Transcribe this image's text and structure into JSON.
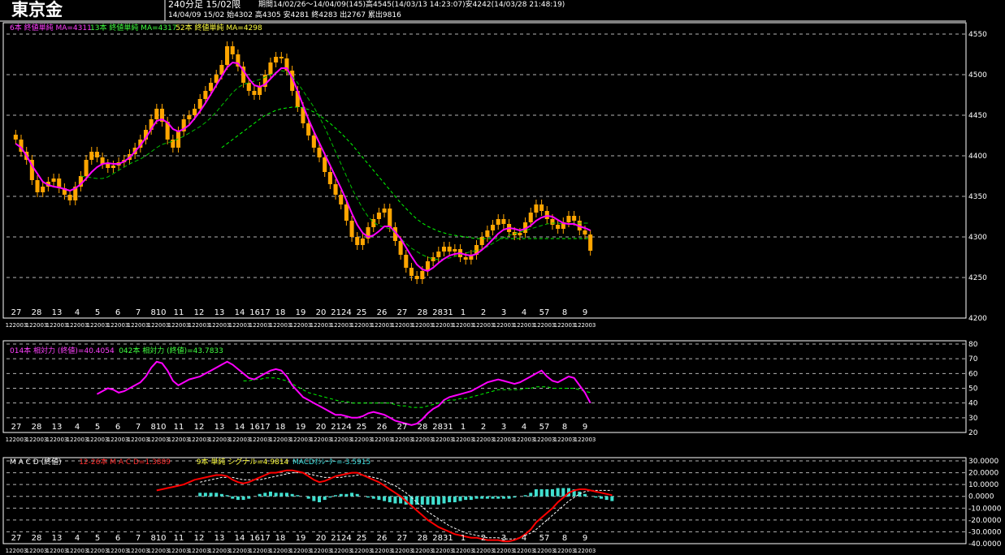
{
  "header": {
    "symbol": "東京金",
    "timeframe": "240分足 15/02限",
    "period": "期間14/02/26～14/04/09(145)高4545(14/03/13 14:23:07)安4242(14/03/28 21:48:19)",
    "current": "14/04/09 15/02 始4302 高4305 安4281 終4283 出2767 累出9816"
  },
  "colors": {
    "up": "#ffa500",
    "ma6": "#ff00ff",
    "ma13": "#00ff00",
    "ma52": "#ffff00",
    "macd": "#ff0000",
    "signal": "#ffffff",
    "osc": "#40e0d0",
    "grid": "#ffffff"
  },
  "legends": {
    "price": [
      {
        "text": "6本 終値単純 MA=4311",
        "color": "#ff40ff"
      },
      {
        "text": "13本 終値単純 MA=4317",
        "color": "#40ff40"
      },
      {
        "text": "52本 終値単純 MA=4298",
        "color": "#ffff40"
      }
    ],
    "rsi": [
      {
        "text": "014本 相対力 (終値)=40.4054",
        "color": "#ff40ff"
      },
      {
        "text": "042本 相対力 (終値)=43.7833",
        "color": "#40ff40"
      }
    ],
    "macd": [
      {
        "text": "M A C D (終値)",
        "color": "#ffffff"
      },
      {
        "text": "12-26本 M A C D=1.3889",
        "color": "#ff3030"
      },
      {
        "text": "9本 単純 シグナル=4.9814",
        "color": "#ffff40"
      },
      {
        "text": "MACDｵｼﾚｰﾀｰ=-3.5915",
        "color": "#40e0e0"
      }
    ]
  },
  "x_day_labels": [
    "27",
    "28",
    "13",
    "4",
    "5",
    "6",
    "7",
    "810",
    "11",
    "12",
    "13",
    "14",
    "1617",
    "18",
    "19",
    "20",
    "2124",
    "25",
    "26",
    "27",
    "28",
    "2831",
    "1",
    "2",
    "3",
    "4",
    "57",
    "8",
    "9"
  ],
  "rsi_x_day_labels": [
    "27",
    "28",
    "13",
    "4",
    "5",
    "6",
    "7",
    "810",
    "11",
    "12",
    "13",
    "14",
    "1617",
    "18",
    "19",
    "20",
    "2124",
    "25",
    "26",
    "27",
    "28",
    "2831",
    "1",
    "2",
    "3",
    "4",
    "57",
    "8",
    "9"
  ],
  "x_hour_label": "12 20 03",
  "chart_data": [
    {
      "type": "candlestick",
      "title": "東京金 240分足 15/02限",
      "ylim": [
        4200,
        4560
      ],
      "y_ticks": [
        4200,
        4250,
        4300,
        4350,
        4400,
        4450,
        4500,
        4550
      ],
      "closes": [
        4420,
        4405,
        4395,
        4370,
        4355,
        4362,
        4368,
        4372,
        4360,
        4352,
        4345,
        4362,
        4375,
        4395,
        4405,
        4398,
        4390,
        4385,
        4388,
        4392,
        4395,
        4402,
        4410,
        4420,
        4432,
        4445,
        4458,
        4442,
        4420,
        4410,
        4430,
        4445,
        4450,
        4458,
        4470,
        4480,
        4490,
        4500,
        4512,
        4535,
        4525,
        4510,
        4490,
        4480,
        4475,
        4485,
        4500,
        4515,
        4522,
        4520,
        4505,
        4480,
        4460,
        4440,
        4425,
        4410,
        4398,
        4380,
        4365,
        4352,
        4340,
        4320,
        4300,
        4290,
        4298,
        4312,
        4322,
        4330,
        4335,
        4312,
        4295,
        4278,
        4262,
        4252,
        4248,
        4258,
        4270,
        4275,
        4282,
        4288,
        4282,
        4285,
        4275,
        4272,
        4278,
        4290,
        4300,
        4308,
        4315,
        4322,
        4316,
        4306,
        4302,
        4305,
        4318,
        4330,
        4340,
        4332,
        4322,
        4315,
        4310,
        4318,
        4326,
        4320,
        4308,
        4303,
        4283
      ],
      "ma6": [
        4415,
        4410,
        4400,
        4388,
        4378,
        4368,
        4364,
        4362,
        4361,
        4359,
        4357,
        4360,
        4365,
        4372,
        4380,
        4386,
        4390,
        4391,
        4390,
        4390,
        4393,
        4398,
        4405,
        4413,
        4422,
        4433,
        4443,
        4445,
        4441,
        4433,
        4430,
        4433,
        4438,
        4446,
        4455,
        4465,
        4476,
        4487,
        4498,
        4509,
        4515,
        4514,
        4505,
        4495,
        4487,
        4485,
        4488,
        4495,
        4502,
        4508,
        4508,
        4496,
        4480,
        4462,
        4445,
        4430,
        4416,
        4402,
        4388,
        4374,
        4360,
        4345,
        4329,
        4315,
        4305,
        4300,
        4302,
        4307,
        4313,
        4313,
        4306,
        4298,
        4287,
        4276,
        4266,
        4260,
        4258,
        4262,
        4268,
        4273,
        4277,
        4279,
        4280,
        4278,
        4277,
        4279,
        4284,
        4290,
        4297,
        4304,
        4309,
        4311,
        4310,
        4308,
        4310,
        4314,
        4320,
        4324,
        4326,
        4325,
        4321,
        4317,
        4316,
        4316,
        4313,
        4311,
        4308
      ],
      "ma13": [
        null,
        null,
        null,
        null,
        null,
        null,
        null,
        null,
        null,
        null,
        null,
        null,
        4375,
        4374,
        4373,
        4372,
        4372,
        4374,
        4378,
        4382,
        4386,
        4390,
        4393,
        4396,
        4400,
        4405,
        4410,
        4414,
        4416,
        4418,
        4421,
        4424,
        4428,
        4432,
        4436,
        4441,
        4447,
        4454,
        4462,
        4470,
        4478,
        4484,
        4488,
        4490,
        4492,
        4494,
        4497,
        4500,
        4503,
        4505,
        4503,
        4498,
        4490,
        4480,
        4470,
        4460,
        4448,
        4435,
        4420,
        4405,
        4390,
        4375,
        4360,
        4347,
        4335,
        4325,
        4318,
        4314,
        4312,
        4310,
        4305,
        4298,
        4292,
        4286,
        4282,
        4278,
        4275,
        4273,
        4272,
        4273,
        4274,
        4276,
        4278,
        4280,
        4282,
        4283,
        4285,
        4288,
        4292,
        4296,
        4299,
        4302,
        4304,
        4306,
        4308,
        4310,
        4312,
        4314,
        4316,
        4317,
        4317,
        4316,
        4316,
        4317,
        4317,
        4317,
        4317
      ],
      "ma52": [
        null,
        null,
        null,
        null,
        null,
        null,
        null,
        null,
        null,
        null,
        null,
        null,
        null,
        null,
        null,
        null,
        null,
        null,
        null,
        null,
        null,
        null,
        null,
        null,
        null,
        null,
        null,
        null,
        null,
        null,
        null,
        null,
        null,
        null,
        null,
        null,
        null,
        null,
        4410,
        4415,
        4420,
        4425,
        4430,
        4435,
        4440,
        4445,
        4450,
        4453,
        4456,
        4458,
        4459,
        4460,
        4460,
        4459,
        4457,
        4454,
        4450,
        4445,
        4440,
        4434,
        4428,
        4421,
        4414,
        4406,
        4398,
        4390,
        4382,
        4374,
        4366,
        4358,
        4350,
        4342,
        4335,
        4328,
        4322,
        4317,
        4313,
        4310,
        4307,
        4305,
        4303,
        4302,
        4301,
        4300,
        4299,
        4298,
        4298,
        4298,
        4298,
        4298,
        4298,
        4298,
        4298,
        4298,
        4298,
        4298,
        4298,
        4298,
        4298,
        4298,
        4298,
        4298,
        4298,
        4298,
        4298,
        4298,
        4298
      ]
    },
    {
      "type": "line",
      "title": "相対力",
      "ylim": [
        20,
        80
      ],
      "y_ticks": [
        20,
        30,
        40,
        50,
        60,
        70,
        80
      ],
      "rsi14": [
        null,
        null,
        null,
        null,
        null,
        null,
        null,
        null,
        null,
        null,
        null,
        null,
        null,
        null,
        null,
        46,
        48,
        50,
        49,
        47,
        48,
        50,
        52,
        54,
        58,
        64,
        68,
        67,
        62,
        55,
        52,
        54,
        56,
        57,
        58,
        60,
        62,
        64,
        66,
        68,
        66,
        63,
        60,
        57,
        56,
        58,
        60,
        62,
        63,
        62,
        58,
        52,
        48,
        44,
        42,
        40,
        38,
        36,
        34,
        32,
        32,
        31,
        30,
        30,
        31,
        33,
        34,
        33,
        32,
        30,
        28,
        27,
        26,
        25,
        26,
        29,
        33,
        36,
        38,
        42,
        44,
        45,
        46,
        47,
        48,
        50,
        52,
        54,
        55,
        56,
        55,
        54,
        53,
        54,
        56,
        58,
        60,
        62,
        58,
        55,
        54,
        56,
        58,
        57,
        52,
        47,
        40
      ],
      "rsi42": [
        null,
        null,
        null,
        null,
        null,
        null,
        null,
        null,
        null,
        null,
        null,
        null,
        null,
        null,
        null,
        null,
        null,
        null,
        null,
        null,
        null,
        null,
        null,
        null,
        null,
        null,
        null,
        null,
        null,
        null,
        null,
        null,
        null,
        null,
        null,
        null,
        null,
        null,
        null,
        null,
        null,
        null,
        55,
        55,
        56,
        56,
        57,
        57,
        57,
        56,
        55,
        53,
        51,
        49,
        47,
        46,
        45,
        44,
        43,
        42,
        41,
        41,
        40,
        40,
        40,
        40,
        40,
        40,
        40,
        40,
        39,
        38,
        38,
        37,
        37,
        37,
        38,
        39,
        40,
        41,
        42,
        42,
        43,
        43,
        44,
        45,
        46,
        47,
        48,
        49,
        49,
        49,
        49,
        49,
        50,
        50,
        51,
        51,
        51,
        50,
        50,
        50,
        50,
        50,
        49,
        48,
        47
      ]
    },
    {
      "type": "line",
      "title": "M A C D (終値)",
      "ylim": [
        -40,
        30
      ],
      "y_ticks": [
        30,
        20,
        10,
        0,
        -10,
        -20,
        -30,
        -40
      ],
      "y_tick_labels": [
        "30.0000",
        "20.0000",
        "10.0000",
        "0.0000",
        "-10.0000",
        "-20.0000",
        "-30.0000",
        "-40.0000"
      ],
      "macd": [
        null,
        null,
        null,
        null,
        null,
        null,
        null,
        null,
        null,
        null,
        null,
        null,
        null,
        null,
        null,
        null,
        null,
        null,
        null,
        null,
        null,
        null,
        null,
        null,
        null,
        null,
        5,
        6,
        7,
        8,
        9,
        10,
        12,
        14,
        15,
        16,
        17,
        18,
        18,
        17,
        14,
        12,
        11,
        12,
        14,
        16,
        18,
        20,
        20,
        21,
        22,
        22,
        21,
        20,
        17,
        14,
        12,
        13,
        15,
        17,
        18,
        19,
        20,
        20,
        18,
        16,
        14,
        12,
        9,
        6,
        3,
        0,
        -4,
        -8,
        -12,
        -16,
        -20,
        -23,
        -26,
        -28,
        -30,
        -32,
        -33,
        -34,
        -35,
        -35,
        -36,
        -37,
        -37,
        -37,
        -38,
        -38,
        -37,
        -35,
        -32,
        -28,
        -22,
        -18,
        -14,
        -10,
        -5,
        -1,
        3,
        5,
        6,
        6,
        5,
        4,
        3,
        2,
        1
      ],
      "signal": [
        null,
        null,
        null,
        null,
        null,
        null,
        null,
        null,
        null,
        null,
        null,
        null,
        null,
        null,
        null,
        null,
        null,
        null,
        null,
        null,
        null,
        null,
        null,
        null,
        null,
        null,
        null,
        null,
        null,
        null,
        null,
        null,
        null,
        null,
        12,
        13,
        14,
        15,
        16,
        16,
        16,
        15,
        14,
        14,
        14,
        14,
        15,
        16,
        17,
        18,
        19,
        20,
        20,
        20,
        19,
        18,
        17,
        16,
        16,
        16,
        16,
        17,
        17,
        18,
        18,
        17,
        16,
        15,
        13,
        11,
        9,
        6,
        3,
        -1,
        -5,
        -9,
        -13,
        -16,
        -19,
        -22,
        -25,
        -27,
        -29,
        -31,
        -32,
        -33,
        -34,
        -35,
        -35,
        -35,
        -36,
        -36,
        -36,
        -35,
        -33,
        -31,
        -28,
        -24,
        -20,
        -16,
        -12,
        -8,
        -4,
        -1,
        2,
        4,
        5,
        5,
        5,
        5,
        5
      ],
      "osc": [
        null,
        null,
        null,
        null,
        null,
        null,
        null,
        null,
        null,
        null,
        null,
        null,
        null,
        null,
        null,
        null,
        null,
        null,
        null,
        null,
        null,
        null,
        null,
        null,
        null,
        null,
        null,
        null,
        null,
        null,
        null,
        null,
        null,
        null,
        3,
        3,
        3,
        3,
        2,
        1,
        -2,
        -3,
        -3,
        -2,
        0,
        2,
        3,
        4,
        3,
        3,
        3,
        2,
        1,
        0,
        -2,
        -4,
        -5,
        -3,
        -1,
        1,
        2,
        2,
        3,
        2,
        0,
        -1,
        -2,
        -3,
        -4,
        -5,
        -6,
        -6,
        -7,
        -7,
        -7,
        -7,
        -7,
        -7,
        -7,
        -6,
        -5,
        -5,
        -4,
        -3,
        -3,
        -2,
        -2,
        -2,
        -2,
        -2,
        -2,
        -2,
        -1,
        0,
        1,
        3,
        6,
        6,
        6,
        6,
        7,
        7,
        7,
        6,
        4,
        2,
        0,
        -1,
        -2,
        -3,
        -4
      ]
    }
  ]
}
